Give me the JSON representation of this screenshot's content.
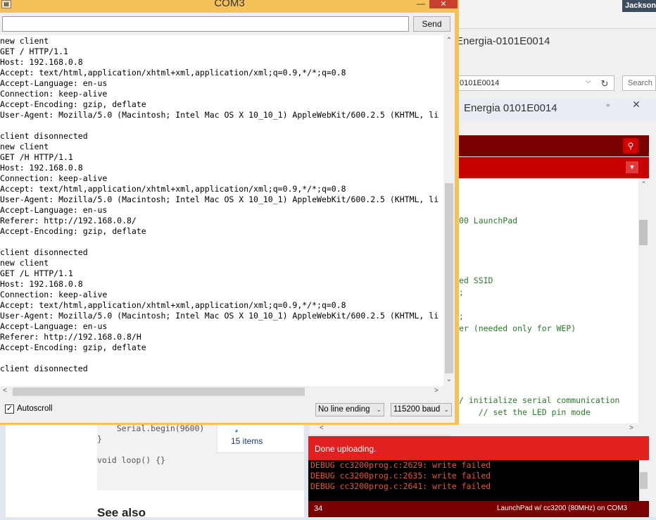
{
  "user": {
    "name": "Jackson"
  },
  "explorer": {
    "title": "Energia-0101E0014",
    "address": "0101E0014",
    "search_placeholder": "Search",
    "items_count": "15 items"
  },
  "ide": {
    "title": "Energia 0101E0014",
    "code_lines": [
      "00 LaunchPad",
      "ed SSID",
      ";",
      ";",
      "er (needed only for WEP)",
      "/ initialize serial communication",
      "    // set the LED pin mode"
    ],
    "status": "Done uploading.",
    "console": [
      "DEBUG cc3200prog.c:2629: write failed",
      "DEBUG cc3200prog.c:2635: write failed",
      "DEBUG cc3200prog.c:2641: write failed"
    ],
    "footer_line": "34",
    "footer_board": "LaunchPad w/ cc3200 (80MHz) on COM3"
  },
  "webpage": {
    "code": [
      "    Serial.begin(9600)",
      "}",
      "",
      "void loop() {}"
    ],
    "see_also": "See also"
  },
  "serial_monitor": {
    "title": "COM3",
    "send_label": "Send",
    "input_value": "",
    "output_lines": [
      "new client",
      "GET / HTTP/1.1",
      "Host: 192.168.0.8",
      "Accept: text/html,application/xhtml+xml,application/xml;q=0.9,*/*;q=0.8",
      "Accept-Language: en-us",
      "Connection: keep-alive",
      "Accept-Encoding: gzip, deflate",
      "User-Agent: Mozilla/5.0 (Macintosh; Intel Mac OS X 10_10_1) AppleWebKit/600.2.5 (KHTML, li",
      "",
      "client disonnected",
      "new client",
      "GET /H HTTP/1.1",
      "Host: 192.168.0.8",
      "Connection: keep-alive",
      "Accept: text/html,application/xhtml+xml,application/xml;q=0.9,*/*;q=0.8",
      "User-Agent: Mozilla/5.0 (Macintosh; Intel Mac OS X 10_10_1) AppleWebKit/600.2.5 (KHTML, li",
      "Accept-Language: en-us",
      "Referer: http://192.168.0.8/",
      "Accept-Encoding: gzip, deflate",
      "",
      "client disonnected",
      "new client",
      "GET /L HTTP/1.1",
      "Host: 192.168.0.8",
      "Connection: keep-alive",
      "Accept: text/html,application/xhtml+xml,application/xml;q=0.9,*/*;q=0.8",
      "User-Agent: Mozilla/5.0 (Macintosh; Intel Mac OS X 10_10_1) AppleWebKit/600.2.5 (KHTML, li",
      "Accept-Language: en-us",
      "Referer: http://192.168.0.8/H",
      "Accept-Encoding: gzip, deflate",
      "",
      "client disonnected"
    ],
    "autoscroll_label": "Autoscroll",
    "autoscroll_checked": true,
    "line_ending": "No line ending",
    "baud_rate": "115200 baud"
  }
}
